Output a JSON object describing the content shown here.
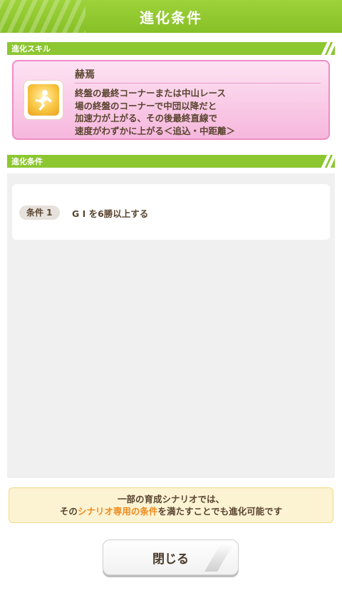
{
  "header": {
    "title": "進化条件"
  },
  "sections": {
    "skill_label": "進化スキル",
    "condition_label": "進化条件"
  },
  "skill": {
    "icon": "golden-runner-icon",
    "name": "赫焉",
    "description": "終盤の最終コーナーまたは中山レース\n場の終盤のコーナーで中団以降だと\n加速力が上がる、その後最終直線で\n速度がわずかに上がる＜追込・中距離＞"
  },
  "conditions": [
    {
      "badge": "条件 1",
      "text": "G I を6勝以上する"
    }
  ],
  "note": {
    "line1": "一部の育成シナリオでは、",
    "line2_pre": "その",
    "line2_highlight": "シナリオ専用の条件",
    "line2_post": "を満たすことでも進化可能です"
  },
  "buttons": {
    "close_label": "閉じる"
  },
  "colors": {
    "header_green": "#8cc631",
    "skill_pink": "#f6b7dd",
    "highlight_orange": "#ef8a1c",
    "note_bg": "#fcf3d3"
  }
}
